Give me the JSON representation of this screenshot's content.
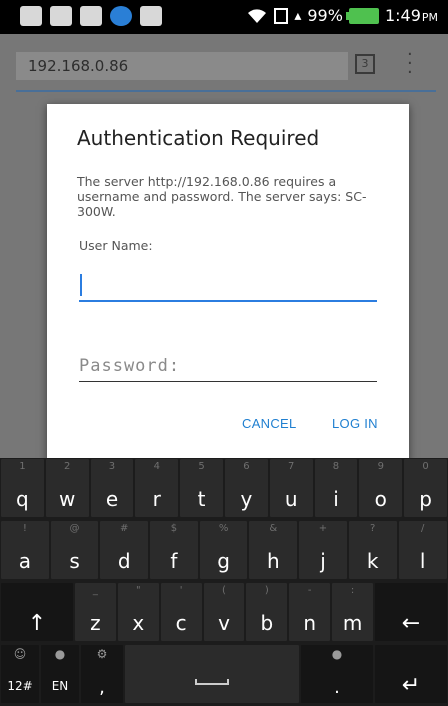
{
  "status_bar": {
    "battery": "99%",
    "time": "1:49",
    "time_suffix": "PM"
  },
  "browser": {
    "url": "192.168.0.86",
    "tab_count": "3"
  },
  "dialog": {
    "title": "Authentication Required",
    "message": "The server http://192.168.0.86 requires a username and password. The server says: SC-300W.",
    "username_label": "User Name:",
    "username_value": "",
    "password_placeholder": "Password:",
    "cancel_label": "CANCEL",
    "login_label": "LOG IN"
  },
  "keyboard": {
    "row1": [
      {
        "hint": "1",
        "key": "q"
      },
      {
        "hint": "2",
        "key": "w"
      },
      {
        "hint": "3",
        "key": "e"
      },
      {
        "hint": "4",
        "key": "r"
      },
      {
        "hint": "5",
        "key": "t"
      },
      {
        "hint": "6",
        "key": "y"
      },
      {
        "hint": "7",
        "key": "u"
      },
      {
        "hint": "8",
        "key": "i"
      },
      {
        "hint": "9",
        "key": "o"
      },
      {
        "hint": "0",
        "key": "p"
      }
    ],
    "row2": [
      {
        "hint": "!",
        "key": "a"
      },
      {
        "hint": "@",
        "key": "s"
      },
      {
        "hint": "#",
        "key": "d"
      },
      {
        "hint": "$",
        "key": "f"
      },
      {
        "hint": "%",
        "key": "g"
      },
      {
        "hint": "&",
        "key": "h"
      },
      {
        "hint": "+",
        "key": "j"
      },
      {
        "hint": "?",
        "key": "k"
      },
      {
        "hint": "/",
        "key": "l"
      }
    ],
    "row3": [
      {
        "hint": "_",
        "key": "z"
      },
      {
        "hint": "\"",
        "key": "x"
      },
      {
        "hint": "'",
        "key": "c"
      },
      {
        "hint": "(",
        "key": "v"
      },
      {
        "hint": ")",
        "key": "b"
      },
      {
        "hint": "-",
        "key": "n"
      },
      {
        "hint": ":",
        "key": "m"
      }
    ],
    "row4": {
      "symbols_label": "12#",
      "language_label": "EN",
      "comma": ",",
      "period": "."
    }
  }
}
